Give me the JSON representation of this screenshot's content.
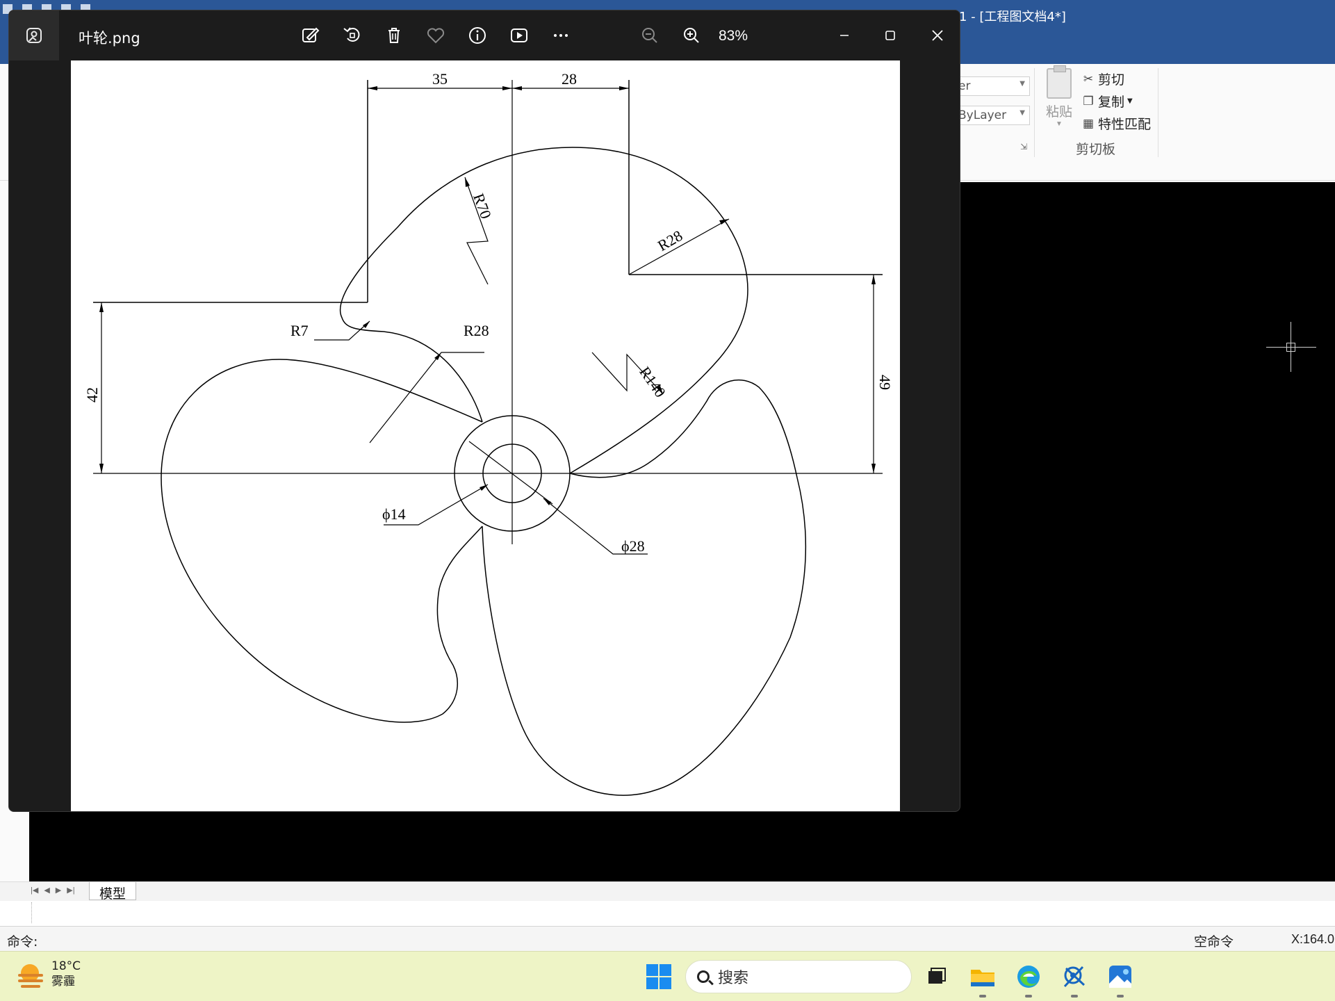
{
  "cad": {
    "title": "1 - [工程图文档4*]",
    "ribbon": {
      "layer_combo": "er",
      "linetype_combo": "ByLayer",
      "paste_label": "粘贴",
      "cut_label": "剪切",
      "copy_label": "复制",
      "match_label": "特性匹配",
      "group_label": "剪切板"
    },
    "model_tab": "模型",
    "command_label": "命令:",
    "status_command": "空命令",
    "coords": "X:164.0"
  },
  "viewer": {
    "file_name": "叶轮.png",
    "zoom": "83%",
    "toolbar": [
      "edit-image",
      "rotate",
      "delete",
      "favorite",
      "file-info",
      "slideshow",
      "more"
    ]
  },
  "drawing": {
    "dimensions": {
      "d35": "35",
      "d28_top": "28",
      "d42": "42",
      "d49": "49",
      "r70": "R70",
      "r28_top": "R28",
      "r7": "R7",
      "r28_left": "R28",
      "r140": "R140",
      "phi14": "ϕ14",
      "phi28": "ϕ28"
    }
  },
  "taskbar": {
    "temperature": "18°C",
    "weather_desc": "雾霾",
    "search_placeholder": "搜索",
    "colors": {
      "start": "#1a8cf0",
      "background": "#eef4c6"
    }
  }
}
